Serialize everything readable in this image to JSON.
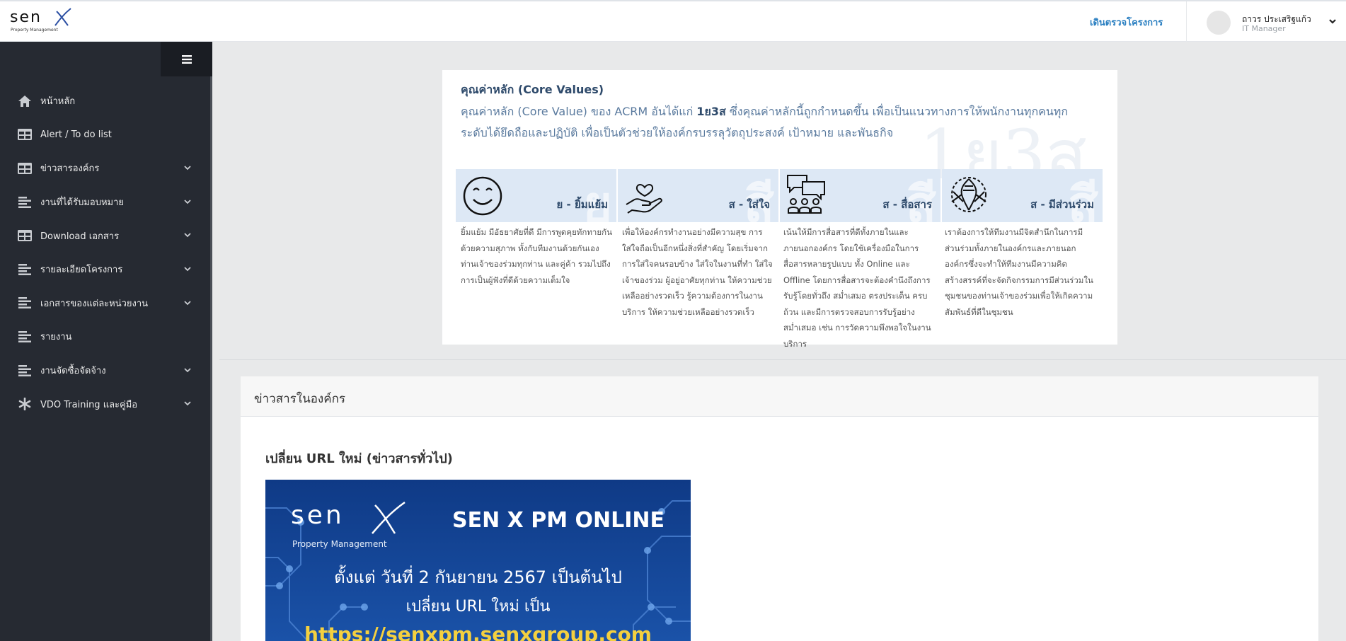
{
  "header": {
    "logo_text": "sen",
    "logo_sub": "Property Management",
    "nav_link": "เดินตรวจโครงการ",
    "user_name": "ถาวร ประเสริฐแก้ว",
    "user_role": "IT Manager"
  },
  "sidebar": {
    "items": [
      {
        "label": "หน้าหลัก",
        "icon": "home-icon",
        "has_submenu": false
      },
      {
        "label": "Alert / To do list",
        "icon": "table-icon",
        "has_submenu": false
      },
      {
        "label": "ข่าวสารองค์กร",
        "icon": "table-icon",
        "has_submenu": true
      },
      {
        "label": "งานที่ได้รับมอบหมาย",
        "icon": "list-icon",
        "has_submenu": true
      },
      {
        "label": "Download เอกสาร",
        "icon": "table-icon",
        "has_submenu": true
      },
      {
        "label": "รายละเอียดโครงการ",
        "icon": "list-icon",
        "has_submenu": true
      },
      {
        "label": "เอกสารของแต่ละหน่วยงาน",
        "icon": "list-icon",
        "has_submenu": true
      },
      {
        "label": "รายงาน",
        "icon": "list-icon",
        "has_submenu": false
      },
      {
        "label": "งานจัดซื้อจัดจ้าง",
        "icon": "list-icon",
        "has_submenu": true
      },
      {
        "label": "VDO Training และคู่มือ",
        "icon": "asterisk-icon",
        "has_submenu": true
      }
    ]
  },
  "core_values": {
    "title": "คุณค่าหลัก (Core Values)",
    "desc_pre": "คุณค่าหลัก (Core Value) ของ ACRM อันได้แก่ ",
    "desc_bold": "1ย3ส",
    "desc_post": " ซึ่งคุณค่าหลักนี้ถูกกำหนดขึ้น เพื่อเป็นแนวทางการให้พนักงานทุกคนทุกระดับได้ยึดถือและปฏิบัติ เพื่อเป็นตัวช่วยให้องค์กรบรรลุวัตถุประสงค์ เป้าหมาย และพันธกิจ",
    "watermark": "1ย3ส",
    "values": [
      {
        "label": "ย - ยิ้มแย้ม",
        "bg_letter": "ย",
        "icon": "smile-icon",
        "text": "ยิ้มแย้ม มีอัธยาศัยที่ดี มีการพูดคุยทักทายกันด้วยความสุภาพ ทั้งกับทีมงานด้วยกันเอง ท่านเจ้าของร่วมทุกท่าน และคู่ค้า รวมไปถึงการเป็นผู้ฟังที่ดีด้วยความเต็มใจ"
      },
      {
        "label": "ส - ใส่ใจ",
        "bg_letter": "สี",
        "icon": "heart-hand-icon",
        "text": "เพื่อให้องค์กรทำงานอย่างมีความสุข การใส่ใจถือเป็นอีกหนึ่งสิ่งที่สำคัญ โดยเริ่มจากการใส่ใจคนรอบข้าง ใส่ใจในงานที่ทำ ใส่ใจเจ้าของร่วม ผู้อยู่อาศัยทุกท่าน ให้ความช่วยเหลืออย่างรวดเร็ว รู้ความต้องการในงานบริการ ให้ความช่วยเหลืออย่างรวดเร็ว"
      },
      {
        "label": "ส - สื่อสาร",
        "bg_letter": "สี",
        "icon": "chat-group-icon",
        "text": "เน้นให้มีการสื่อสารที่ดีทั้งภายในและภายนอกองค์กร โดยใช้เครื่องมือในการสื่อสารหลายรูปแบบ ทั้ง Online และ Offline โดยการสื่อสารจะต้องคำนึงถึงการรับรู้โดยทั่วถึง สม่ำเสมอ ตรงประเด็น ครบถ้วน และมีการตรวจสอบการรับรู้อย่างสม่ำเสมอ เช่น การวัดความพึงพอใจในงานบริการ"
      },
      {
        "label": "ส - มีส่วนร่วม",
        "bg_letter": "สี",
        "icon": "hands-together-icon",
        "text": "เราต้องการให้ทีมงานมีจิตสำนึกในการมีส่วนร่วมทั้งภายในองค์กรและภายนอกองค์กรซึ่งจะทำให้ทีมงานมีความคิดสร้างสรรค์ที่จะจัดกิจกรรมการมีส่วนร่วมในชุมชนของท่านเจ้าของร่วมเพื่อให้เกิดความสัมพันธ์ที่ดีในชุมชน"
      }
    ]
  },
  "news": {
    "section_title": "ข่าวสารในองค์กร",
    "post_title": "เปลี่ยน URL ใหม่ (ข่าวสารทั่วไป)",
    "banner": {
      "logo_text": "sen",
      "logo_sub": "Property Management",
      "title": "SEN X PM ONLINE",
      "line1": "ตั้งแต่ วันที่ 2 กันยายน 2567 เป็นต้นไป",
      "line2": "เปลี่ยน URL ใหม่ เป็น",
      "url": "https://senxpm.senxgroup.com"
    }
  },
  "colors": {
    "sidebar_bg": "#262a32",
    "accent_link": "#2a7fc1",
    "value_band": "#dde8f5",
    "banner_blue": "#1a52a8",
    "banner_url": "#f4d03f"
  }
}
